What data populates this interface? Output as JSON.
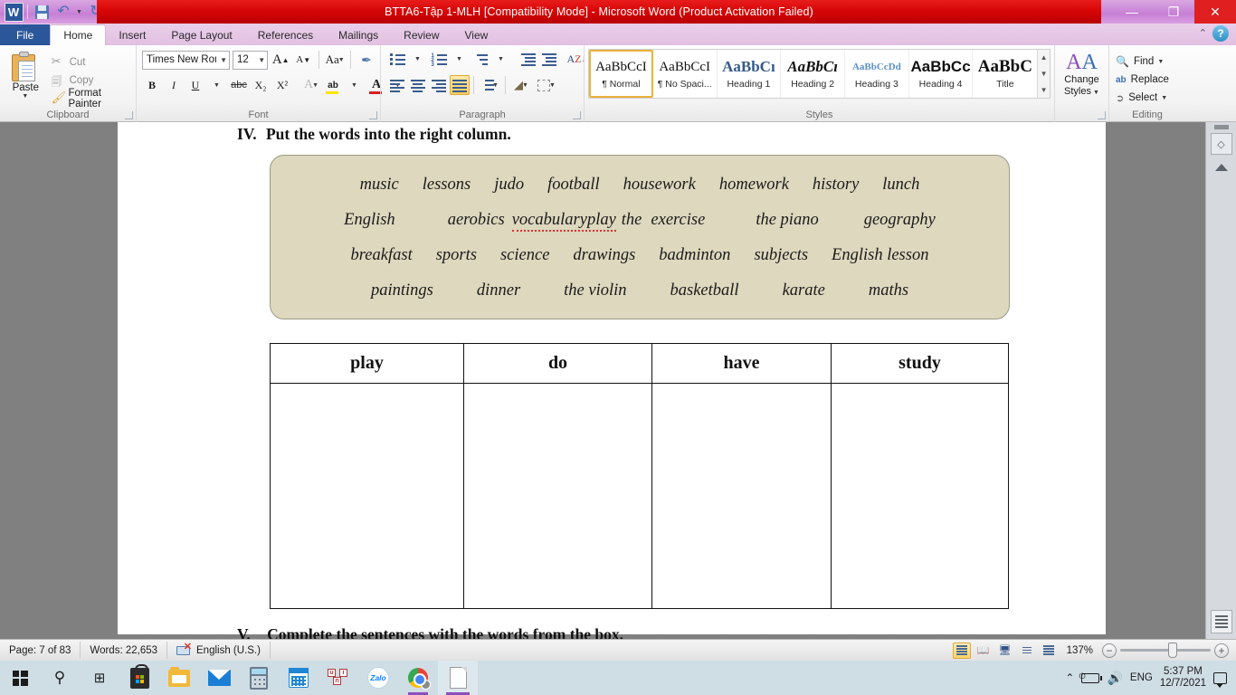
{
  "window": {
    "title": "BTTA6-Tập 1-MLH [Compatibility Mode]  -  Microsoft Word (Product Activation Failed)",
    "app_logo": "W",
    "minimize": "—",
    "restore": "❐",
    "close": "✕",
    "help": "?",
    "collapse_ribbon": "⌃"
  },
  "quick_access": [
    {
      "name": "save",
      "icon": "save-icon"
    },
    {
      "name": "undo",
      "icon": "undo-icon",
      "glyph": "↶"
    },
    {
      "name": "redo",
      "icon": "redo-icon",
      "glyph": "↻"
    },
    {
      "name": "customize",
      "icon": "customize-qat-icon",
      "glyph": "≡"
    }
  ],
  "tabs": [
    {
      "label": "File",
      "active": false
    },
    {
      "label": "Home",
      "active": true
    },
    {
      "label": "Insert",
      "active": false
    },
    {
      "label": "Page Layout",
      "active": false
    },
    {
      "label": "References",
      "active": false
    },
    {
      "label": "Mailings",
      "active": false
    },
    {
      "label": "Review",
      "active": false
    },
    {
      "label": "View",
      "active": false
    }
  ],
  "ribbon": {
    "clipboard": {
      "group_label": "Clipboard",
      "paste": "Paste",
      "cut": "Cut",
      "copy": "Copy",
      "format_painter": "Format Painter"
    },
    "font": {
      "group_label": "Font",
      "font_name": "Times New Rom",
      "font_size": "12",
      "grow_font": "A",
      "shrink_font": "A",
      "change_case": "Aa",
      "clear_formatting": "✐",
      "bold": "B",
      "italic": "I",
      "underline": "U",
      "strikethrough": "abc",
      "subscript": "X₂",
      "superscript": "X²",
      "text_effects": "A",
      "highlight": "ab",
      "font_color": "A",
      "highlight_color": "#ffe400",
      "font_color_value": "#d81f1f"
    },
    "paragraph": {
      "group_label": "Paragraph",
      "bullets": "bullets-icon",
      "numbering": "numbering-icon",
      "multilevel": "multilevel-list-icon",
      "decrease_indent": "decrease-indent-icon",
      "increase_indent": "increase-indent-icon",
      "sort": "sort-icon",
      "show_marks": "¶",
      "align_left": "align-left-icon",
      "align_center": "align-center-icon",
      "align_right": "align-right-icon",
      "justify": "justify-icon",
      "justify_active": true,
      "line_spacing": "line-spacing-icon",
      "shading": "shading-icon",
      "borders": "borders-icon"
    },
    "styles": {
      "group_label": "Styles",
      "items": [
        {
          "sample": "AaBbCcI",
          "name": "¶ Normal",
          "selected": true
        },
        {
          "sample": "AaBbCcI",
          "name": "¶ No Spaci...",
          "selected": false
        },
        {
          "sample": "AaBbCı",
          "name": "Heading 1",
          "selected": false
        },
        {
          "sample": "AaBbCı",
          "name": "Heading 2",
          "selected": false
        },
        {
          "sample": "AaBbCcDd",
          "name": "Heading 3",
          "selected": false
        },
        {
          "sample": "AaBbCc",
          "name": "Heading 4",
          "selected": false
        },
        {
          "sample": "AaBbC",
          "name": "Title",
          "selected": false
        }
      ],
      "change_styles_line1": "Change",
      "change_styles_line2": "Styles"
    },
    "editing": {
      "group_label": "Editing",
      "find": "Find",
      "replace": "Replace",
      "select": "Select"
    }
  },
  "document": {
    "exercise4_number": "IV.",
    "exercise4_title": "Put the words into the right column.",
    "word_box_lines": [
      [
        {
          "text": "music"
        },
        {
          "text": "lessons"
        },
        {
          "text": "judo"
        },
        {
          "text": "football"
        },
        {
          "text": "housework"
        },
        {
          "text": "homework"
        },
        {
          "text": "history"
        },
        {
          "text": "lunch"
        }
      ],
      [
        {
          "text": "English"
        },
        {
          "text": "aerobics"
        },
        {
          "text": "vocabularyplay",
          "misspelled": true
        },
        {
          "text": "the"
        },
        {
          "text": "exercise"
        },
        {
          "text": "the piano"
        },
        {
          "text": "geography"
        }
      ],
      [
        {
          "text": "breakfast"
        },
        {
          "text": "sports"
        },
        {
          "text": "science"
        },
        {
          "text": "drawings"
        },
        {
          "text": "badminton"
        },
        {
          "text": "subjects"
        },
        {
          "text": "English lesson"
        }
      ],
      [
        {
          "text": "paintings"
        },
        {
          "text": "dinner"
        },
        {
          "text": "the violin"
        },
        {
          "text": "basketball"
        },
        {
          "text": "karate"
        },
        {
          "text": "maths"
        }
      ]
    ],
    "table_headers": [
      "play",
      "do",
      "have",
      "study"
    ],
    "table_body_cells": [
      "",
      "",
      "",
      ""
    ],
    "exercise5_number": "V.",
    "exercise5_title": "Complete the sentences with the words from the box."
  },
  "status_bar": {
    "page": "Page: 7 of 83",
    "words": "Words: 22,653",
    "language": "English (U.S.)",
    "proofing_icon": "spelling-errors-icon",
    "zoom_level": "137%",
    "zoom_out": "−",
    "zoom_in": "+",
    "views": [
      {
        "name": "print-layout-view",
        "selected": true
      },
      {
        "name": "full-screen-reading-view",
        "selected": false
      },
      {
        "name": "web-layout-view",
        "selected": false
      },
      {
        "name": "outline-view",
        "selected": false
      },
      {
        "name": "draft-view",
        "selected": false
      }
    ]
  },
  "taskbar": {
    "items": [
      {
        "name": "start-button",
        "icon": "windows-logo-icon"
      },
      {
        "name": "search-button",
        "icon": "search-icon",
        "glyph": "⌕"
      },
      {
        "name": "task-view-button",
        "icon": "task-view-icon"
      },
      {
        "name": "microsoft-store",
        "icon": "store-icon"
      },
      {
        "name": "file-explorer",
        "icon": "folder-icon"
      },
      {
        "name": "mail",
        "icon": "mail-icon"
      },
      {
        "name": "calculator",
        "icon": "calculator-icon"
      },
      {
        "name": "calendar",
        "icon": "calendar-icon"
      },
      {
        "name": "unikey",
        "icon": "unikey-icon"
      },
      {
        "name": "zalo",
        "icon": "zalo-icon",
        "label": "Zalo"
      },
      {
        "name": "google-chrome",
        "icon": "chrome-icon"
      },
      {
        "name": "microsoft-word",
        "icon": "word-document-icon",
        "active": true
      }
    ],
    "tray": {
      "show_hidden": "⌃",
      "battery": "battery-icon",
      "volume": "volume-icon",
      "language": "ENG",
      "time": "5:37 PM",
      "date": "12/7/2021",
      "action_center": "notifications-icon"
    }
  }
}
